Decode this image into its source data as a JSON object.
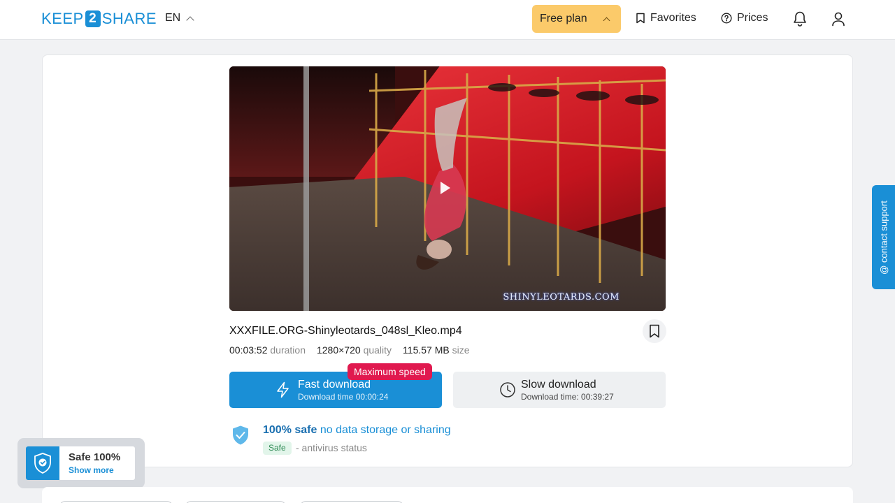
{
  "header": {
    "logo_left": "KEEP",
    "logo_mid": "2",
    "logo_right": "SHARE",
    "language": "EN",
    "plan_label": "Free plan",
    "favorites_label": "Favorites",
    "prices_label": "Prices"
  },
  "video": {
    "watermark": "SHINYLEOTARDS.COM"
  },
  "file": {
    "name": "XXXFILE.ORG-Shinyleotards_048sl_Kleo.mp4",
    "duration_value": "00:03:52",
    "duration_label": "duration",
    "quality_value": "1280×720",
    "quality_label": "quality",
    "size_value": "115.57 MB",
    "size_label": "size"
  },
  "downloads": {
    "badge": "Maximum speed",
    "fast_title": "Fast download",
    "fast_sub": "Download time 00:00:24",
    "slow_title": "Slow download",
    "slow_sub": "Download time: 00:39:27"
  },
  "safety": {
    "headline_bold": "100% safe",
    "headline_rest": " no data storage or sharing",
    "badge": "Safe",
    "status": "- antivirus status"
  },
  "support": {
    "label": "@ contact support"
  },
  "safe_widget": {
    "title": "Safe 100%",
    "link": "Show more"
  },
  "colors": {
    "accent": "#1a8fd6",
    "plan": "#fbca6a",
    "badge": "#e0194f"
  }
}
